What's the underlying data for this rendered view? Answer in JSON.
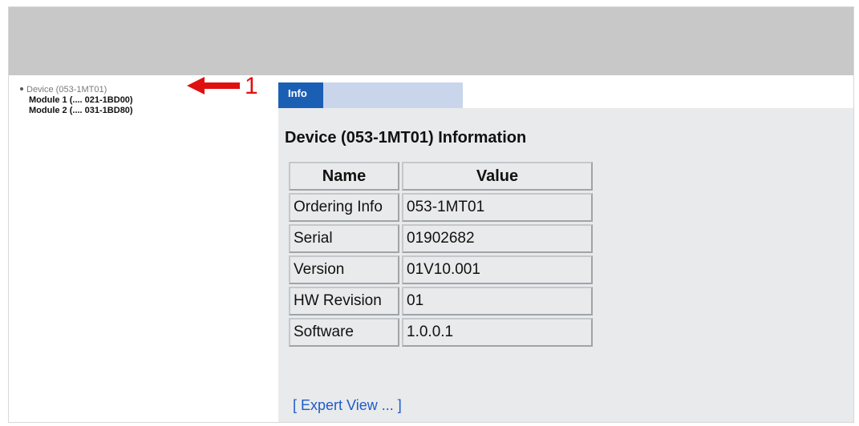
{
  "tree": {
    "items": [
      {
        "label": "Device (053-1MT01)"
      },
      {
        "label": "Module 1 (.... 021-1BD00)"
      },
      {
        "label": "Module 2 (.... 031-1BD80)"
      }
    ]
  },
  "annotation": {
    "number": "1",
    "color": "#e01010"
  },
  "tabs": {
    "info_label": "Info"
  },
  "info": {
    "title": "Device (053-1MT01) Information",
    "headers": {
      "name": "Name",
      "value": "Value"
    },
    "rows": [
      {
        "name": "Ordering Info",
        "value": "053-1MT01"
      },
      {
        "name": "Serial",
        "value": "01902682"
      },
      {
        "name": "Version",
        "value": "01V10.001"
      },
      {
        "name": "HW Revision",
        "value": "01"
      },
      {
        "name": "Software",
        "value": "1.0.0.1"
      }
    ],
    "expert_link": "[ Expert View ... ]"
  },
  "colors": {
    "accent": "#1a5fb4",
    "tab_inactive": "#c9d5ea",
    "banner": "#c8c8c8",
    "panel": "#e8eaec",
    "link": "#1f5bc8"
  }
}
